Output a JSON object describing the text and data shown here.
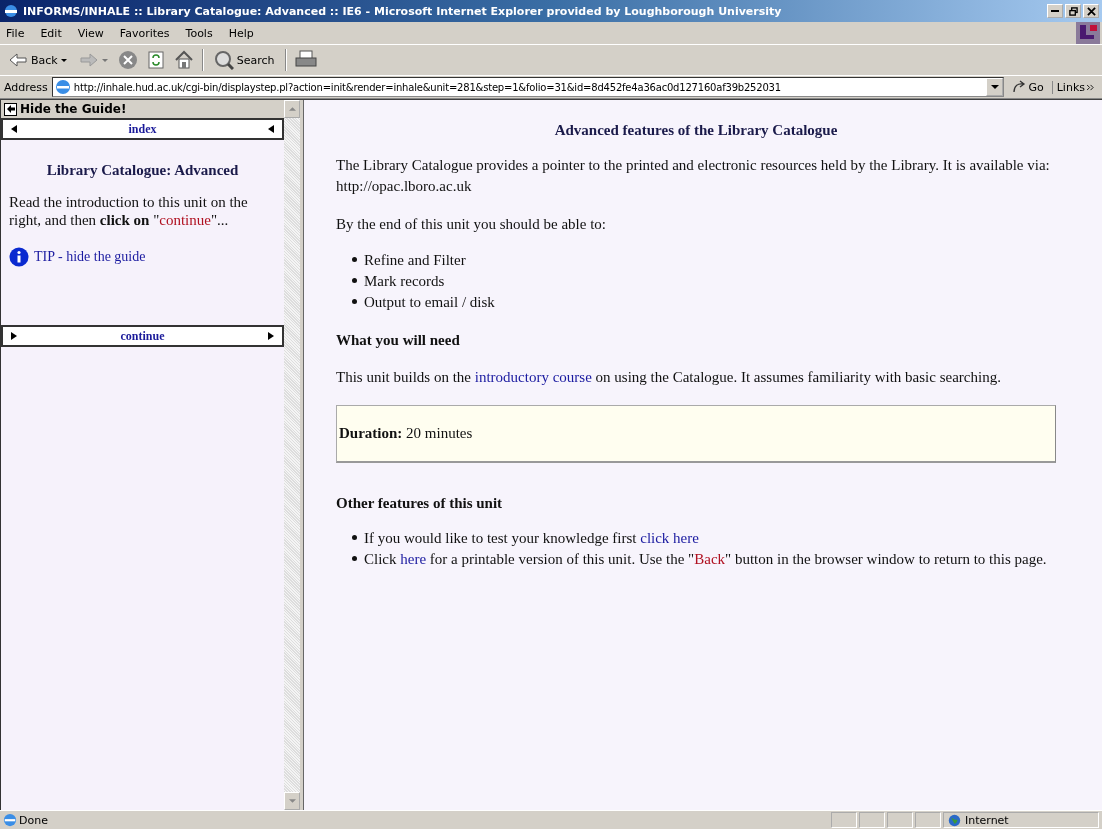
{
  "window": {
    "title": "INFORMS/INHALE :: Library Catalogue: Advanced :: IE6 - Microsoft Internet Explorer provided by Loughborough University"
  },
  "menu": [
    "File",
    "Edit",
    "View",
    "Favorites",
    "Tools",
    "Help"
  ],
  "toolbar": {
    "back": "Back",
    "search": "Search"
  },
  "address": {
    "label": "Address",
    "value": "http://inhale.hud.ac.uk/cgi-bin/displaystep.pl?action=init&render=inhale&unit=281&step=1&folio=31&id=8d452fe4a36ac0d127160af39b252031",
    "go": "Go",
    "links": "Links"
  },
  "guide": {
    "hide": "Hide the Guide!",
    "index": "index",
    "title": "Library Catalogue: Advanced",
    "intro": [
      {
        "kind": "plain",
        "text": "Read the introduction to this unit on the right, and then "
      },
      {
        "kind": "bold",
        "text": "click on"
      },
      {
        "kind": "plain",
        "text": " \""
      },
      {
        "kind": "red",
        "text": "continue"
      },
      {
        "kind": "plain",
        "text": "\"..."
      }
    ],
    "tip": "TIP - hide the guide",
    "continue": "continue"
  },
  "content": {
    "heading": "Advanced features of the Library Catalogue",
    "blocks": [
      {
        "kind": "para",
        "parts": [
          {
            "kind": "plain",
            "text": "The Library Catalogue provides a pointer to the printed and electronic resources held by the Library. It is available via: http://opac.lboro.ac.uk"
          }
        ]
      },
      {
        "kind": "para",
        "parts": [
          {
            "kind": "plain",
            "text": "By the end of this unit you should be able to:"
          }
        ]
      },
      {
        "kind": "list",
        "items": [
          [
            {
              "kind": "plain",
              "text": "Refine and Filter"
            }
          ],
          [
            {
              "kind": "plain",
              "text": "Mark records"
            }
          ],
          [
            {
              "kind": "plain",
              "text": "Output to email / disk"
            }
          ]
        ]
      },
      {
        "kind": "heading",
        "text": "What you will need"
      },
      {
        "kind": "para",
        "parts": [
          {
            "kind": "plain",
            "text": "This unit builds on the "
          },
          {
            "kind": "link",
            "text": "introductory course"
          },
          {
            "kind": "plain",
            "text": " on using the Catalogue. It assumes familiarity with basic searching."
          }
        ]
      },
      {
        "kind": "box",
        "label": "Duration:",
        "text": "20 minutes"
      },
      {
        "kind": "heading",
        "text": "Other features of this unit"
      },
      {
        "kind": "list",
        "items": [
          [
            {
              "kind": "plain",
              "text": "If you would like to test your knowledge first "
            },
            {
              "kind": "link",
              "text": "click here"
            }
          ],
          [
            {
              "kind": "plain",
              "text": "Click "
            },
            {
              "kind": "link",
              "text": "here"
            },
            {
              "kind": "plain",
              "text": " for a printable version of this unit. Use the \""
            },
            {
              "kind": "red",
              "text": "Back"
            },
            {
              "kind": "plain",
              "text": "\" button in the browser window to return to this page."
            }
          ]
        ]
      }
    ]
  },
  "status": {
    "text": "Done",
    "zone": "Internet"
  }
}
